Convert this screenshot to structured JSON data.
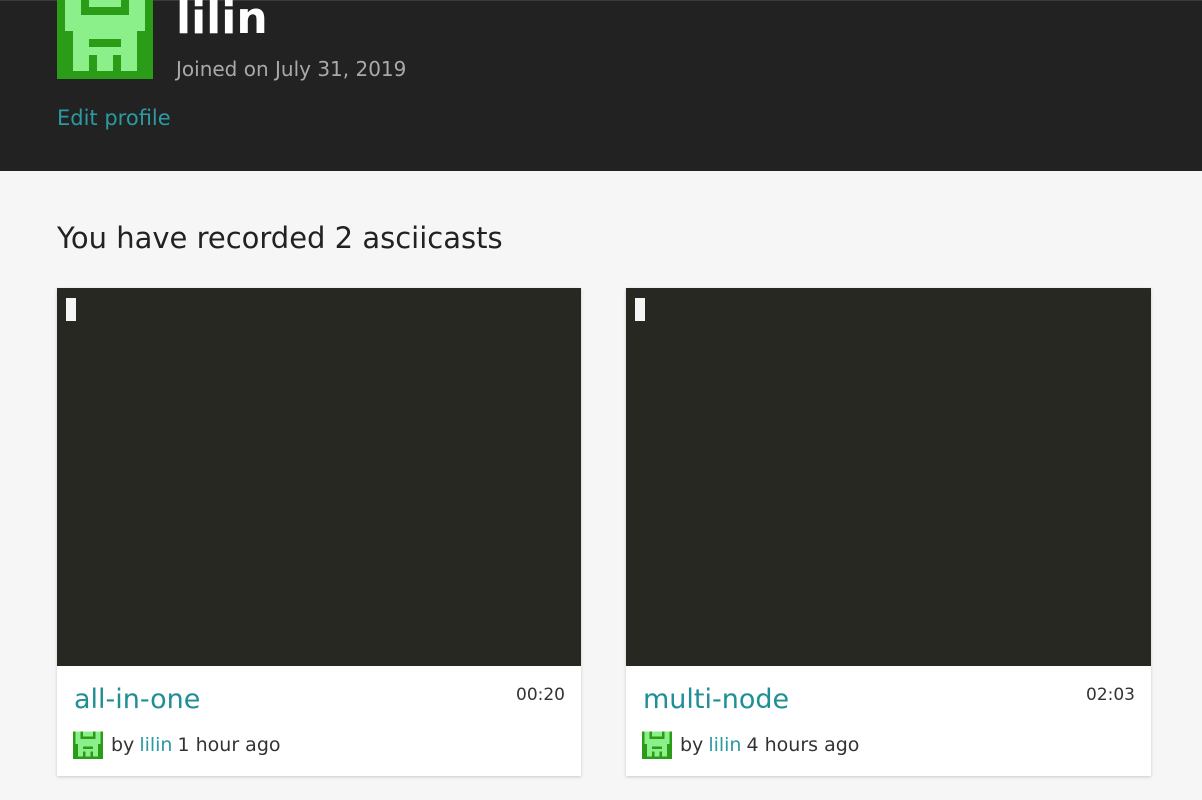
{
  "profile": {
    "username": "lilin",
    "joined": "Joined on July 31, 2019",
    "edit_profile_label": "Edit profile",
    "avatar_icon": "pixel-identicon-icon",
    "avatar_colors": {
      "background": "#2a9c17",
      "foreground": "#8bf08a"
    }
  },
  "casts_section": {
    "heading": "You have recorded 2 asciicasts"
  },
  "casts": [
    {
      "title": "all-in-one",
      "duration": "00:20",
      "by_label": "by",
      "author": "lilin",
      "time_ago": "1 hour ago"
    },
    {
      "title": "multi-node",
      "duration": "02:03",
      "by_label": "by",
      "author": "lilin",
      "time_ago": "4 hours ago"
    }
  ],
  "colors": {
    "header_bg": "#222222",
    "page_bg": "#f6f6f6",
    "accent": "#2b9aa1",
    "terminal_bg": "#282823"
  }
}
